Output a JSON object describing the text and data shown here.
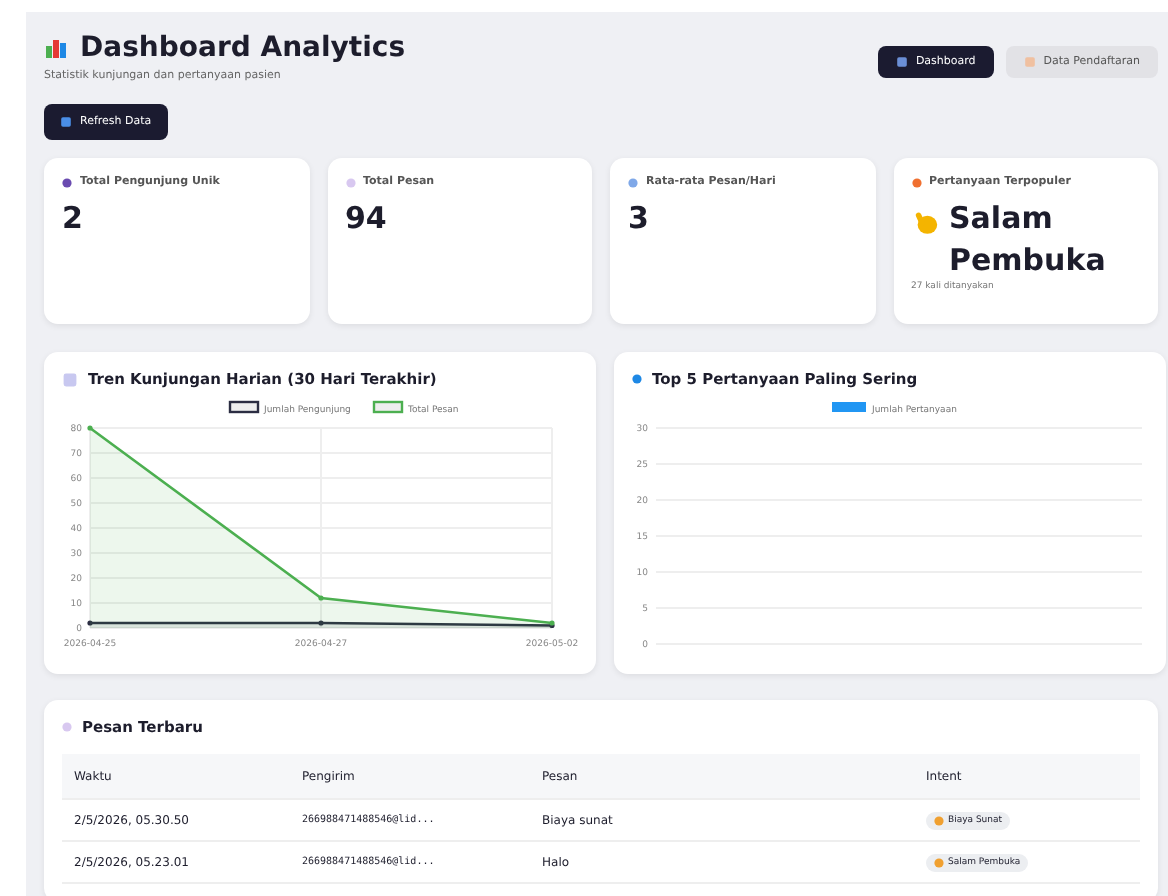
{
  "header": {
    "title": "Dashboard Analytics",
    "subtitle": "Statistik kunjungan dan pertanyaan pasien"
  },
  "nav": [
    {
      "label": "Dashboard",
      "selected": true
    },
    {
      "label": "Data Pendaftaran",
      "selected": false
    }
  ],
  "refresh_button": "Refresh Data",
  "stats": [
    {
      "label": "Total Pengunjung Unik",
      "value": "2"
    },
    {
      "label": "Total Pesan",
      "value": "94"
    },
    {
      "label": "Rata-rata Pesan/Hari",
      "value": "3"
    },
    {
      "label": "Pertanyaan Terpopuler",
      "value": "Salam Pembuka",
      "note": "27 kali ditanyakan"
    }
  ],
  "trend_chart": {
    "title": "Tren Kunjungan Harian (30 Hari Terakhir)",
    "chart_data": {
      "type": "area",
      "grid": true,
      "legend": true,
      "categories": [
        "2026-04-25",
        "2026-04-27",
        "2026-05-02"
      ],
      "series": [
        {
          "name": "Jumlah Pengunjung",
          "color": "#2b2d42",
          "values": [
            2,
            2,
            1
          ]
        },
        {
          "name": "Total Pesan",
          "color": "#4caf50",
          "values": [
            80,
            12,
            2
          ]
        }
      ],
      "ylim": [
        0,
        80
      ],
      "yticks": [
        0,
        10,
        20,
        30,
        40,
        50,
        60,
        70,
        80
      ]
    }
  },
  "top_chart": {
    "title": "Top 5 Pertanyaan Paling Sering",
    "chart_data": {
      "type": "bar",
      "grid": true,
      "legend": true,
      "series": [
        {
          "name": "Jumlah Pertanyaan",
          "color": "#2196f3"
        }
      ],
      "ylim": [
        0,
        30
      ],
      "yticks": [
        0,
        5,
        10,
        15,
        20,
        25,
        30
      ]
    }
  },
  "messages": {
    "title": "Pesan Terbaru",
    "columns": [
      "Waktu",
      "Pengirim",
      "Pesan",
      "Intent"
    ],
    "rows": [
      {
        "time": "2/5/2026, 05.30.50",
        "sender": "266988471488546@lid...",
        "message": "Biaya sunat",
        "intent": "Biaya Sunat"
      },
      {
        "time": "2/5/2026, 05.23.01",
        "sender": "266988471488546@lid...",
        "message": "Halo",
        "intent": "Salam Pembuka"
      }
    ]
  }
}
